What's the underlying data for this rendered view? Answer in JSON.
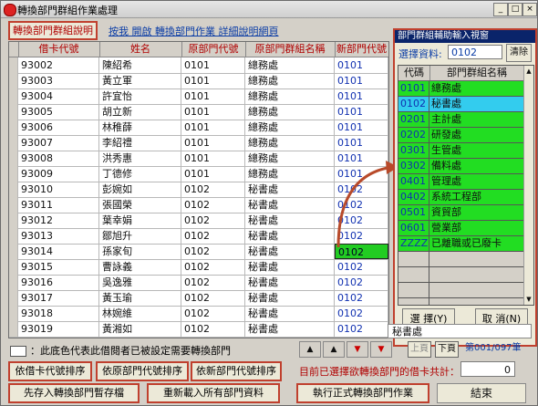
{
  "window": {
    "title": "轉換部門群組作業處理",
    "min": "_",
    "max": "□",
    "close": "×"
  },
  "top": {
    "link_btn": "轉換部門群組說明",
    "link_text": "按我 開啟 轉換部門作業 詳細說明網頁"
  },
  "grid": {
    "headers": [
      "借卡代號",
      "姓名",
      "原部門代號",
      "原部門群組名稱",
      "新部門代號"
    ],
    "rows": [
      [
        "93002",
        "陳紹希",
        "0101",
        "總務處",
        "0101"
      ],
      [
        "93003",
        "黃立軍",
        "0101",
        "總務處",
        "0101"
      ],
      [
        "93004",
        "許宜怡",
        "0101",
        "總務處",
        "0101"
      ],
      [
        "93005",
        "胡立新",
        "0101",
        "總務處",
        "0101"
      ],
      [
        "93006",
        "林稚薛",
        "0101",
        "總務處",
        "0101"
      ],
      [
        "93007",
        "李紹禮",
        "0101",
        "總務處",
        "0101"
      ],
      [
        "93008",
        "洪秀惠",
        "0101",
        "總務處",
        "0101"
      ],
      [
        "93009",
        "丁德修",
        "0101",
        "總務處",
        "0101"
      ],
      [
        "93010",
        "彭婉如",
        "0102",
        "秘書處",
        "0102"
      ],
      [
        "93011",
        "張國榮",
        "0102",
        "秘書處",
        "0102"
      ],
      [
        "93012",
        "葉幸娟",
        "0102",
        "秘書處",
        "0102"
      ],
      [
        "93013",
        "鄒旭升",
        "0102",
        "秘書處",
        "0102"
      ],
      [
        "93014",
        "孫家旬",
        "0102",
        "秘書處",
        "0102"
      ],
      [
        "93015",
        "曹詠義",
        "0102",
        "秘書處",
        "0102"
      ],
      [
        "93016",
        "吳逸雅",
        "0102",
        "秘書處",
        "0102"
      ],
      [
        "93017",
        "黃玉瑜",
        "0102",
        "秘書處",
        "0102"
      ],
      [
        "93018",
        "林婉維",
        "0102",
        "秘書處",
        "0102"
      ],
      [
        "93019",
        "黃湘如",
        "0102",
        "秘書處",
        "0102"
      ]
    ],
    "scroll_value": "秘書處"
  },
  "popup": {
    "title": "部門群組輔助輸入視窗",
    "select_label": "選擇資料:",
    "select_value": "0102",
    "clear": "清除",
    "headers": [
      "代碼",
      "部門群組名稱"
    ],
    "rows": [
      [
        "0101",
        "總務處"
      ],
      [
        "0102",
        "秘書處"
      ],
      [
        "0201",
        "主計處"
      ],
      [
        "0202",
        "研發處"
      ],
      [
        "0301",
        "生管處"
      ],
      [
        "0302",
        "備料處"
      ],
      [
        "0401",
        "管理處"
      ],
      [
        "0402",
        "系統工程部"
      ],
      [
        "0501",
        "資貿部"
      ],
      [
        "0601",
        "營業部"
      ],
      [
        "ZZZZ",
        "已離職或已廢卡"
      ]
    ],
    "ok": "選 擇(Y)",
    "cancel": "取 消(N)"
  },
  "legend": "：此底色代表此借閱者已被設定需要轉換部門",
  "pager": {
    "prev": "上頁",
    "next": "下頁",
    "info": "第001/097筆"
  },
  "buttons": {
    "sort_card": "依借卡代號排序",
    "sort_old": "依原部門代號排序",
    "sort_new": "依新部門代號排序",
    "save_temp": "先存入轉換部門暫存檔",
    "reload": "重新載入所有部門資料",
    "execute": "執行正式轉換部門作業",
    "close": "結束"
  },
  "status": {
    "label": "目前已選擇欲轉換部門的借卡共計：",
    "count": "0"
  },
  "colors": {
    "accent_red": "#c0402e",
    "highlight_green": "#22cc22",
    "select_cyan": "#33ccee",
    "link_blue": "#0b3da6"
  }
}
